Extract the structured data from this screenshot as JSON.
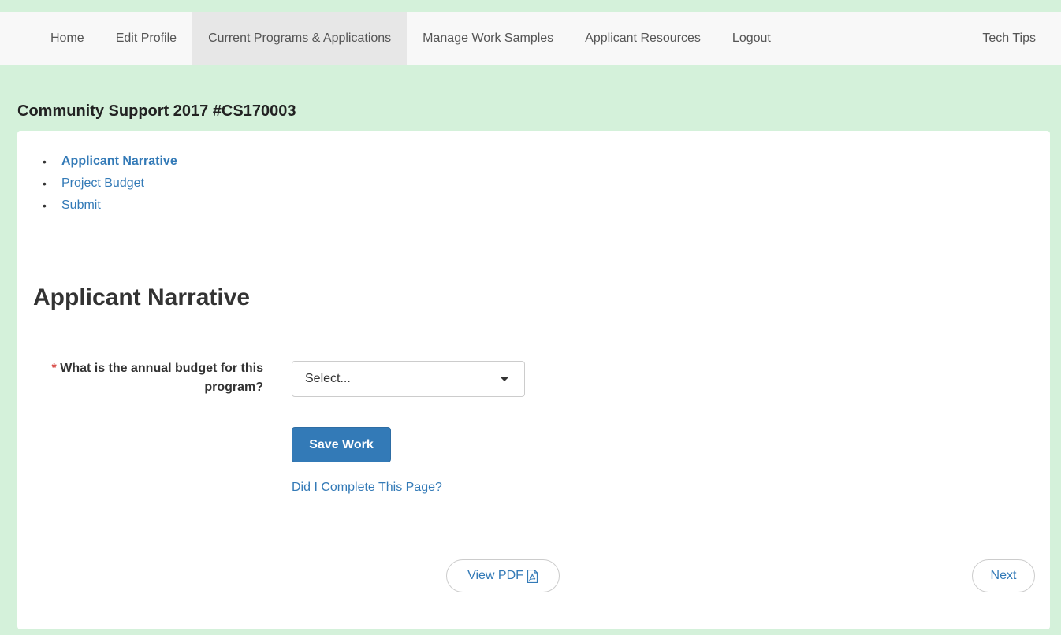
{
  "nav": {
    "items": [
      {
        "label": "Home"
      },
      {
        "label": "Edit Profile"
      },
      {
        "label": "Current Programs & Applications"
      },
      {
        "label": "Manage Work Samples"
      },
      {
        "label": "Applicant Resources"
      },
      {
        "label": "Logout"
      }
    ],
    "right_item": "Tech Tips",
    "active_item": "Current Programs & Applications"
  },
  "program_title": "Community Support 2017 #CS170003",
  "sections": [
    {
      "label": "Applicant Narrative",
      "current": true
    },
    {
      "label": "Project Budget",
      "current": false
    },
    {
      "label": "Submit",
      "current": false
    }
  ],
  "page_heading": "Applicant Narrative",
  "question": {
    "required_marker": "*",
    "label": "What is the annual budget for this program?",
    "select_value": "Select..."
  },
  "save_button_label": "Save Work",
  "complete_link": "Did I Complete This Page?",
  "footer": {
    "pdf_label": "View PDF",
    "next_label": "Next"
  },
  "colors": {
    "background": "#d4f1da",
    "link": "#337ab7",
    "primary_button": "#337ab7",
    "required": "#d9534f"
  },
  "icons": {
    "pdf": "pdf-file-icon",
    "select_caret": "caret-down-icon"
  }
}
